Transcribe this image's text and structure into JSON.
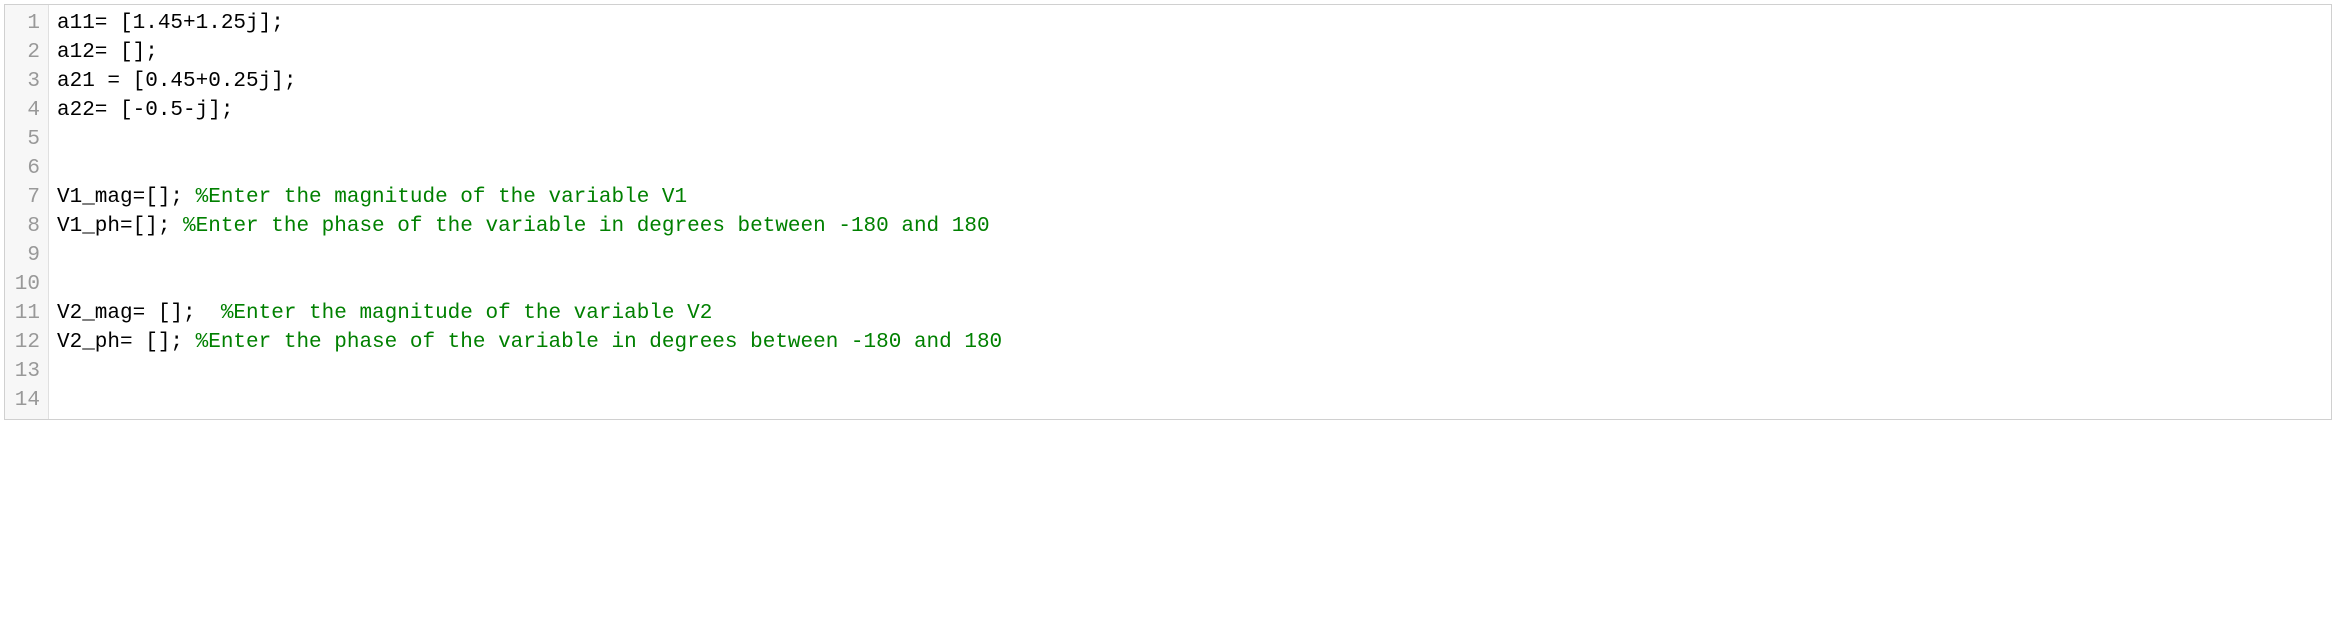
{
  "editor": {
    "lines": [
      {
        "num": "1",
        "segments": [
          {
            "text": "a11= [1.45+1.25j];",
            "type": "code"
          }
        ]
      },
      {
        "num": "2",
        "segments": [
          {
            "text": "a12= [];",
            "type": "code"
          }
        ]
      },
      {
        "num": "3",
        "segments": [
          {
            "text": "a21 = [0.45+0.25j];",
            "type": "code"
          }
        ]
      },
      {
        "num": "4",
        "segments": [
          {
            "text": "a22= [-0.5-j];",
            "type": "code"
          }
        ]
      },
      {
        "num": "5",
        "segments": [
          {
            "text": "",
            "type": "code"
          }
        ]
      },
      {
        "num": "6",
        "segments": [
          {
            "text": "",
            "type": "code"
          }
        ]
      },
      {
        "num": "7",
        "segments": [
          {
            "text": "V1_mag=[]; ",
            "type": "code"
          },
          {
            "text": "%Enter the magnitude of the variable V1",
            "type": "comment"
          }
        ]
      },
      {
        "num": "8",
        "segments": [
          {
            "text": "V1_ph=[]; ",
            "type": "code"
          },
          {
            "text": "%Enter the phase of the variable in degrees between -180 and 180",
            "type": "comment"
          }
        ]
      },
      {
        "num": "9",
        "segments": [
          {
            "text": "",
            "type": "code"
          }
        ]
      },
      {
        "num": "10",
        "segments": [
          {
            "text": "",
            "type": "code"
          }
        ]
      },
      {
        "num": "11",
        "segments": [
          {
            "text": "V2_mag= [];  ",
            "type": "code"
          },
          {
            "text": "%Enter the magnitude of the variable V2",
            "type": "comment"
          }
        ]
      },
      {
        "num": "12",
        "segments": [
          {
            "text": "V2_ph= []; ",
            "type": "code"
          },
          {
            "text": "%Enter the phase of the variable in degrees between -180 and 180",
            "type": "comment"
          }
        ]
      },
      {
        "num": "13",
        "segments": [
          {
            "text": "",
            "type": "code"
          }
        ]
      },
      {
        "num": "14",
        "segments": [
          {
            "text": "",
            "type": "code"
          }
        ]
      }
    ]
  }
}
